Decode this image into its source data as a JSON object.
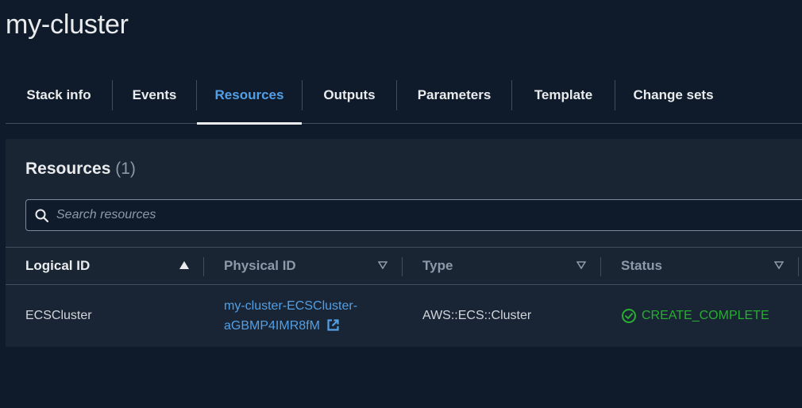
{
  "page": {
    "title": "my-cluster"
  },
  "tabs": [
    {
      "label": "Stack info",
      "active": false
    },
    {
      "label": "Events",
      "active": false
    },
    {
      "label": "Resources",
      "active": true
    },
    {
      "label": "Outputs",
      "active": false
    },
    {
      "label": "Parameters",
      "active": false
    },
    {
      "label": "Template",
      "active": false
    },
    {
      "label": "Change sets",
      "active": false
    }
  ],
  "resources": {
    "title": "Resources",
    "count": "(1)",
    "search_placeholder": "Search resources",
    "columns": [
      "Logical ID",
      "Physical ID",
      "Type",
      "Status"
    ],
    "sorted_column": "Logical ID",
    "rows": [
      {
        "logical_id": "ECSCluster",
        "physical_id_line1": "my-cluster-ECSCluster-",
        "physical_id_line2": "aGBMP4IMR8fM",
        "type": "AWS::ECS::Cluster",
        "status": "CREATE_COMPLETE"
      }
    ]
  },
  "colors": {
    "background": "#0f1b2a",
    "panel": "#1a2533",
    "accent_link": "#539fe5",
    "status_success": "#29ad32",
    "text_primary": "#e9ebed",
    "text_secondary": "#8d99a8",
    "border": "#414d5c"
  },
  "icons": {
    "search": "search-icon",
    "sort_ascending": "sort-ascending-icon",
    "sort_unsorted": "sort-unsorted-icon",
    "external_link": "external-link-icon",
    "status_success": "check-circle-icon"
  }
}
